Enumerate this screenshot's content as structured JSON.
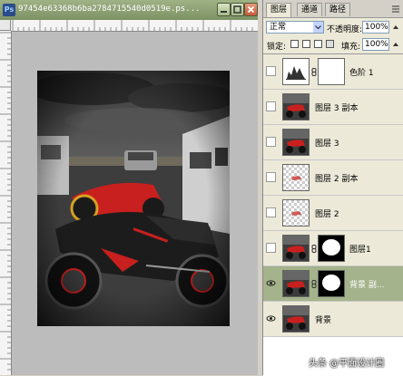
{
  "document": {
    "title": "97454e63368b6ba2784715540d0519e.ps...",
    "app_icon": "Ps",
    "buttons": [
      "minimize-icon",
      "maximize-icon",
      "close-icon"
    ]
  },
  "layers_panel": {
    "tabs": [
      {
        "label": "图层"
      },
      {
        "label": "通道"
      },
      {
        "label": "路径"
      }
    ],
    "blend_mode": "正常",
    "opacity_label": "不透明度:",
    "opacity_value": "100%",
    "lock_label": "锁定:",
    "fill_label": "填充:",
    "fill_value": "100%",
    "layers": [
      {
        "name": "色阶 1",
        "kind": "adjustment",
        "visible": false,
        "selected": false
      },
      {
        "name": "图层 3 副本",
        "kind": "photo",
        "visible": false,
        "selected": false
      },
      {
        "name": "图层 3",
        "kind": "photo",
        "visible": false,
        "selected": false
      },
      {
        "name": "图层 2 副本",
        "kind": "transparent",
        "visible": false,
        "selected": false
      },
      {
        "name": "图层 2",
        "kind": "transparent",
        "visible": false,
        "selected": false
      },
      {
        "name": "图层1",
        "kind": "photo-mask",
        "visible": false,
        "selected": false
      },
      {
        "name": "背景 副...",
        "kind": "photo-mask",
        "visible": true,
        "selected": true
      },
      {
        "name": "背景",
        "kind": "photo",
        "visible": true,
        "selected": false
      }
    ]
  },
  "watermark": "头条 @平面设计圈",
  "colors": {
    "titlebar": "#8ea276",
    "selected_layer": "#a4b38b",
    "bike_red": "#c8201e"
  }
}
